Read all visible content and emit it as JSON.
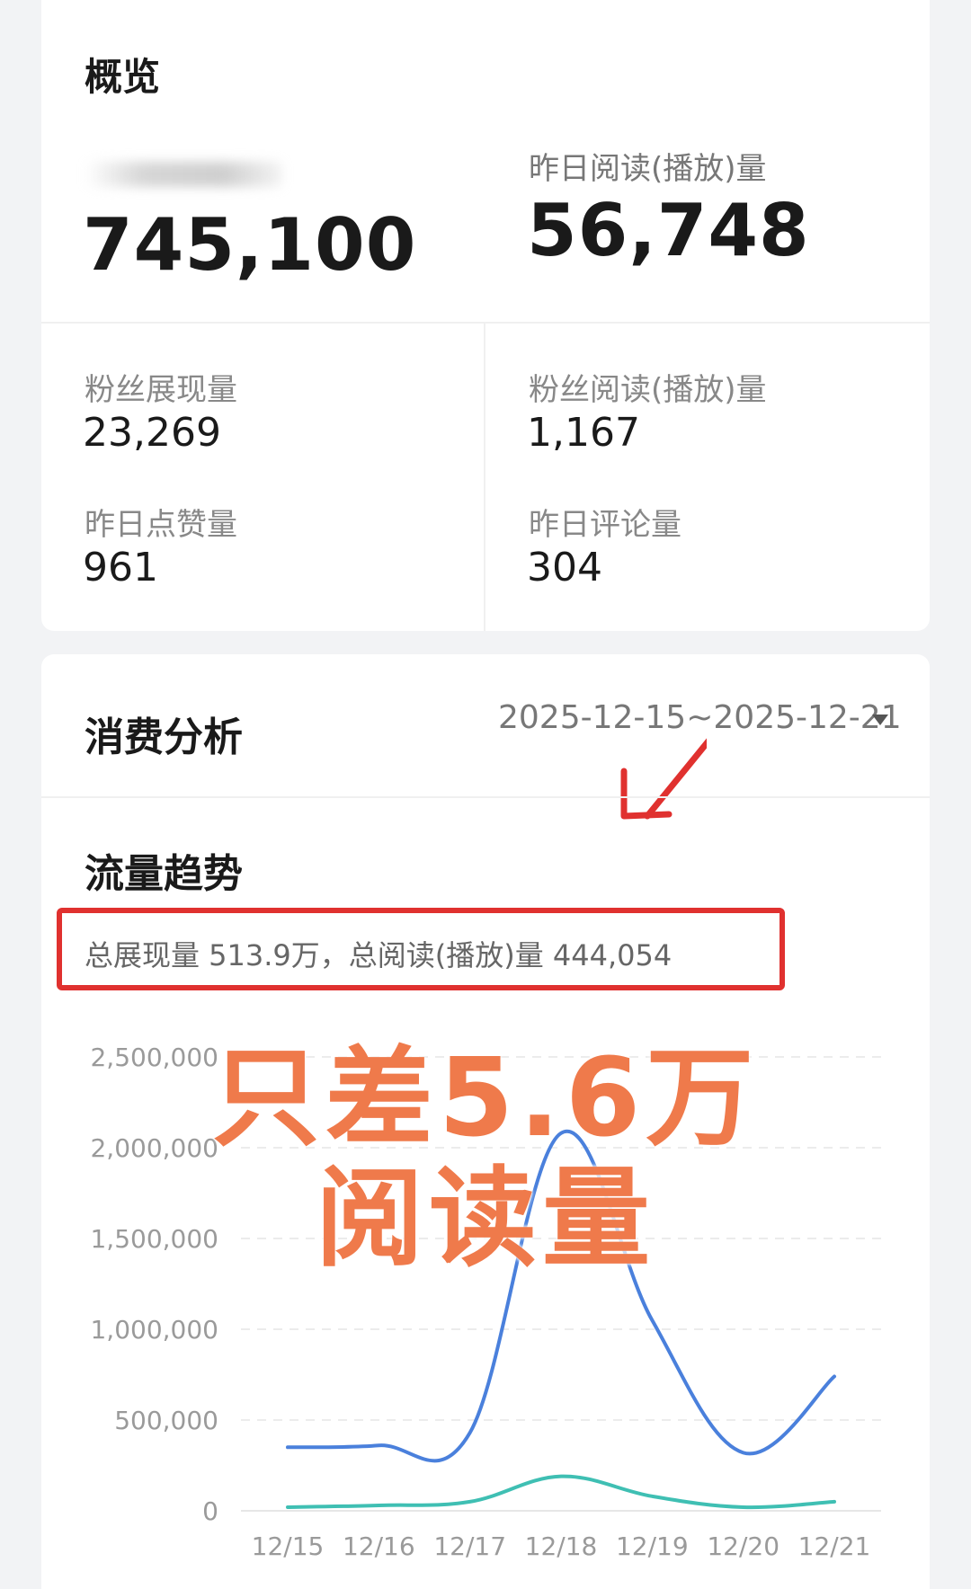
{
  "overview": {
    "title": "概览",
    "total_value": "745,100",
    "yesterday_read_label": "昨日阅读(播放)量",
    "yesterday_read_value": "56,748",
    "stats": [
      {
        "label": "粉丝展现量",
        "value": "23,269"
      },
      {
        "label": "粉丝阅读(播放)量",
        "value": "1,167"
      },
      {
        "label": "昨日点赞量",
        "value": "961"
      },
      {
        "label": "昨日评论量",
        "value": "304"
      }
    ]
  },
  "analysis": {
    "title": "消费分析",
    "date_range": "2025-12-15~2025-12-21",
    "trend_title": "流量趋势",
    "summary": "总展现量 513.9万，总阅读(播放)量 444,054",
    "overlay_line1": "只差5.6万",
    "overlay_line2": "阅读量"
  },
  "colors": {
    "series_impressions": "#4a80dc",
    "series_reads": "#3fbfb3",
    "highlight_box": "#e0312f",
    "overlay_text": "#ef7a4b"
  },
  "chart_data": {
    "type": "line",
    "x": [
      "12/15",
      "12/16",
      "12/17",
      "12/18",
      "12/19",
      "12/20",
      "12/21"
    ],
    "ylim": [
      0,
      2500000
    ],
    "yticks": [
      "2,500,000",
      "2,000,000",
      "1,500,000",
      "1,000,000",
      "500,000",
      "0"
    ],
    "series": [
      {
        "values": [
          350000,
          360000,
          430000,
          2080000,
          1050000,
          320000,
          740000
        ]
      },
      {
        "values": [
          20000,
          30000,
          50000,
          190000,
          80000,
          20000,
          50000
        ]
      }
    ],
    "grid": true,
    "smooth": true
  }
}
